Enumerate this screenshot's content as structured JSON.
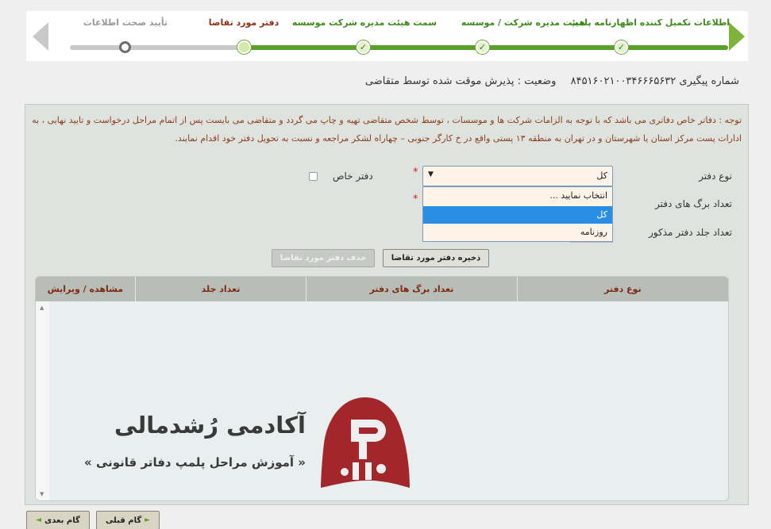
{
  "wizard": {
    "steps": [
      {
        "label": "اطلاعات تکمیل کننده اظهارنامه پلمپ",
        "state": "done"
      },
      {
        "label": "هیئت مدیره شرکت / موسسه",
        "state": "done"
      },
      {
        "label": "سمت هیئت مدیره شرکت موسسه",
        "state": "done"
      },
      {
        "label": "دفتر مورد تقاضا",
        "state": "current"
      },
      {
        "label": "تأیید صحت اطلاعات",
        "state": "todo"
      }
    ],
    "check_glyph": "✓"
  },
  "tracking": {
    "number_text": "شماره پیگیری ۸۴۵۱۶۰۲۱۰۰۳۴۶۶۶۵۶۳۲",
    "status_text": "وضعیت : پذیرش موقت شده توسط متقاضی"
  },
  "note": "توجه : دفاتر خاص دفاتری می باشد که با توجه به الزامات شرکت ها و موسسات ، توسط شخص متقاضی تهیه و چاپ می گردد و متقاضی می بایست پس از اتمام مراحل درخواست و تایید نهایی ، به ادارات پست مرکز استان یا شهرستان و در تهران به منطقه ۱۳ پستی واقع در خ کارگر جنوبی – چهاراه لشکر مراجعه و نسبت به تحویل دفتر خود اقدام نمایند.",
  "form": {
    "book_type_label": "نوع دفتر",
    "pages_label": "تعداد برگ های دفتر",
    "volumes_label": "تعداد جلد دفتر مذکور",
    "special_label": "دفتر خاص",
    "required_mark": "*",
    "select_value": "کل",
    "dropdown_options": [
      "انتخاب نمایید ...",
      "کل",
      "روزنامه"
    ],
    "selected_index": 1
  },
  "buttons": {
    "save": "ذخیره دفتر مورد تقاضا",
    "delete": "حذف دفتر مورد تقاضا",
    "prev": "گام قبلی",
    "next": "گام بعدی"
  },
  "table": {
    "columns": [
      "نوع دفتر",
      "تعداد برگ های دفتر",
      "تعداد جلد",
      "مشاهده / ویرایش"
    ]
  },
  "watermark": {
    "title": "آکادمی رُشدمالی",
    "subtitle": "« آموزش مراحل پلمپ دفاتر قانونی »",
    "logo_color": "#a3262a"
  }
}
